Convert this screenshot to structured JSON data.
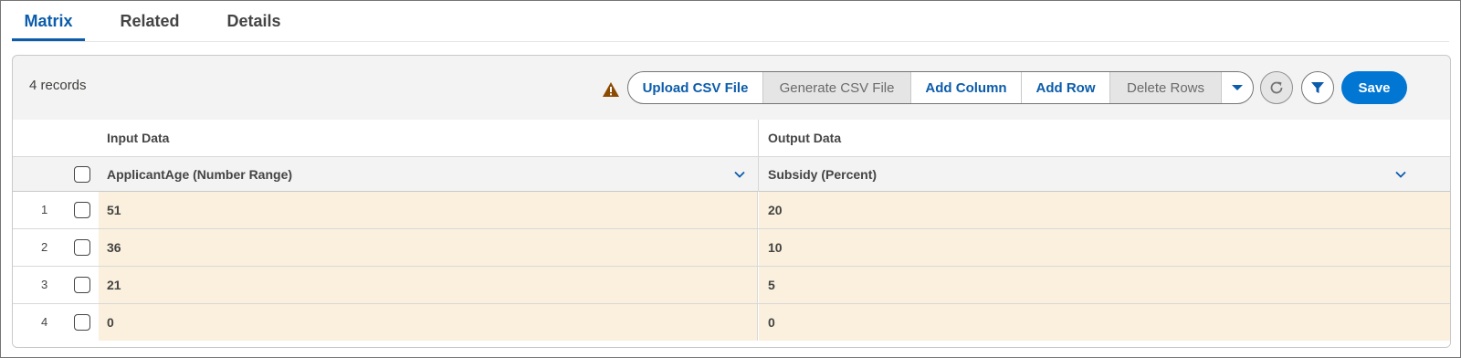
{
  "tabs": [
    {
      "label": "Matrix",
      "active": true
    },
    {
      "label": "Related",
      "active": false
    },
    {
      "label": "Details",
      "active": false
    }
  ],
  "toolbar": {
    "record_count": "4 records",
    "warning_icon": "warning-icon",
    "upload_label": "Upload CSV File",
    "generate_label": "Generate CSV File",
    "add_column_label": "Add Column",
    "add_row_label": "Add Row",
    "delete_rows_label": "Delete Rows",
    "more_icon": "chevron-down-icon",
    "refresh_icon": "refresh-icon",
    "filter_icon": "filter-icon",
    "save_label": "Save"
  },
  "table": {
    "group_headers": {
      "input": "Input Data",
      "output": "Output Data"
    },
    "columns": {
      "input": "ApplicantAge (Number Range)",
      "output": "Subsidy (Percent)"
    },
    "rows": [
      {
        "num": "1",
        "input": "51",
        "output": "20"
      },
      {
        "num": "2",
        "input": "36",
        "output": "10"
      },
      {
        "num": "3",
        "input": "21",
        "output": "5"
      },
      {
        "num": "4",
        "input": "0",
        "output": "0"
      }
    ]
  },
  "colors": {
    "accent": "#0b5cab",
    "brand_button": "#0176d3",
    "row_highlight": "#faf0dd",
    "warning": "#8c4b02"
  }
}
